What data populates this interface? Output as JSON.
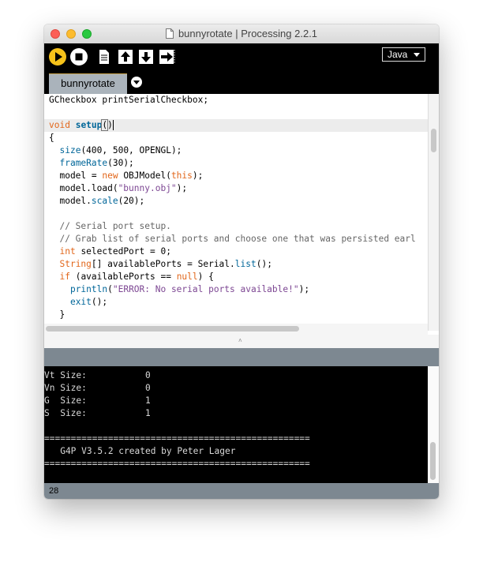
{
  "window": {
    "title": "bunnyrotate | Processing 2.2.1"
  },
  "toolbar": {
    "run": "run-button",
    "stop": "stop-button",
    "new": "new-button",
    "open": "open-button",
    "save": "save-button",
    "export": "export-button",
    "mode": "Java"
  },
  "tabs": [
    {
      "label": "bunnyrotate"
    }
  ],
  "editor": {
    "lines": [
      [
        {
          "t": "GCheckbox printSerialCheckbox;",
          "c": ""
        }
      ],
      [],
      [
        {
          "t": "void",
          "c": "kw"
        },
        {
          "t": " ",
          "c": ""
        },
        {
          "t": "setup",
          "c": "fn-b"
        },
        {
          "t": "(",
          "c": "bracket"
        },
        {
          "t": ")",
          "c": "caret"
        }
      ],
      [
        {
          "t": "{",
          "c": ""
        }
      ],
      [
        {
          "t": "  ",
          "c": ""
        },
        {
          "t": "size",
          "c": "bi"
        },
        {
          "t": "(400, 500, OPENGL);",
          "c": ""
        }
      ],
      [
        {
          "t": "  ",
          "c": ""
        },
        {
          "t": "frameRate",
          "c": "bi"
        },
        {
          "t": "(30);",
          "c": ""
        }
      ],
      [
        {
          "t": "  model = ",
          "c": ""
        },
        {
          "t": "new",
          "c": "kw"
        },
        {
          "t": " OBJModel(",
          "c": ""
        },
        {
          "t": "this",
          "c": "kw"
        },
        {
          "t": ");",
          "c": ""
        }
      ],
      [
        {
          "t": "  model.load(",
          "c": ""
        },
        {
          "t": "\"bunny.obj\"",
          "c": "str"
        },
        {
          "t": ");",
          "c": ""
        }
      ],
      [
        {
          "t": "  model.",
          "c": ""
        },
        {
          "t": "scale",
          "c": "bi"
        },
        {
          "t": "(20);",
          "c": ""
        }
      ],
      [],
      [
        {
          "t": "  // Serial port setup.",
          "c": "cm"
        }
      ],
      [
        {
          "t": "  // Grab list of serial ports and choose one that was persisted earl",
          "c": "cm"
        }
      ],
      [
        {
          "t": "  ",
          "c": ""
        },
        {
          "t": "int",
          "c": "kw"
        },
        {
          "t": " selectedPort = 0;",
          "c": ""
        }
      ],
      [
        {
          "t": "  ",
          "c": ""
        },
        {
          "t": "String",
          "c": "ty"
        },
        {
          "t": "[] availablePorts = Serial.",
          "c": ""
        },
        {
          "t": "list",
          "c": "bi"
        },
        {
          "t": "();",
          "c": ""
        }
      ],
      [
        {
          "t": "  ",
          "c": ""
        },
        {
          "t": "if",
          "c": "kw"
        },
        {
          "t": " (availablePorts == ",
          "c": ""
        },
        {
          "t": "null",
          "c": "kw"
        },
        {
          "t": ") {",
          "c": ""
        }
      ],
      [
        {
          "t": "    ",
          "c": ""
        },
        {
          "t": "println",
          "c": "bi"
        },
        {
          "t": "(",
          "c": ""
        },
        {
          "t": "\"ERROR: No serial ports available!\"",
          "c": "str"
        },
        {
          "t": ");",
          "c": ""
        }
      ],
      [
        {
          "t": "    ",
          "c": ""
        },
        {
          "t": "exit",
          "c": "bi"
        },
        {
          "t": "();",
          "c": ""
        }
      ],
      [
        {
          "t": "  }",
          "c": ""
        }
      ]
    ]
  },
  "console": {
    "lines": [
      "Vt Size:           0",
      "Vn Size:           0",
      "G  Size:           1",
      "S  Size:           1",
      "",
      "==================================================",
      "   G4P V3.5.2 created by Peter Lager",
      "=================================================="
    ]
  },
  "footer": {
    "line_number": "28"
  }
}
